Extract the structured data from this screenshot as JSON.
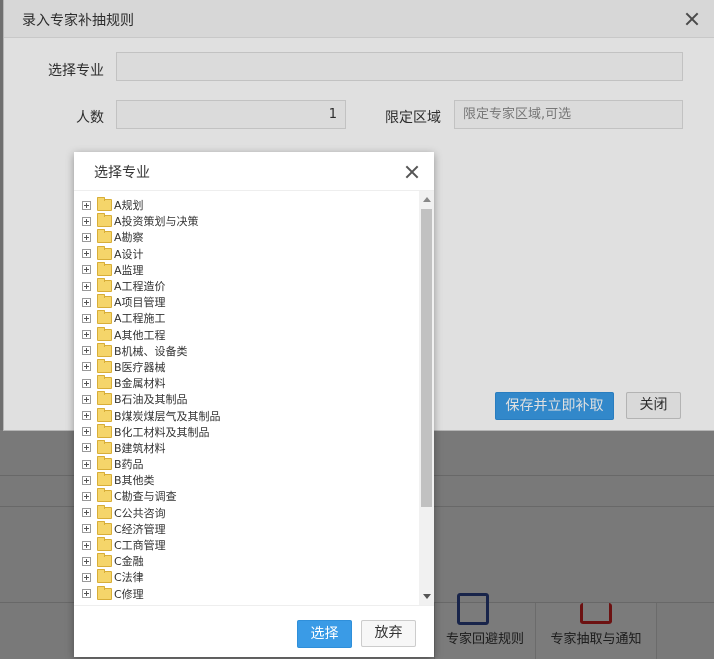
{
  "outer_dialog": {
    "title": "录入专家补抽规则",
    "major_label": "选择专业",
    "major_value": "",
    "count_label": "人数",
    "count_value": "1",
    "region_label": "限定区域",
    "region_placeholder": "限定专家区域,可选",
    "save_button": "保存并立即补取",
    "close_button": "关闭"
  },
  "background": {
    "tiles": [
      "专家回避规则",
      "专家抽取与通知"
    ]
  },
  "inner_dialog": {
    "title": "选择专业",
    "tree_items": [
      "A规划",
      "A投资策划与决策",
      "A勘察",
      "A设计",
      "A监理",
      "A工程造价",
      "A项目管理",
      "A工程施工",
      "A其他工程",
      "B机械、设备类",
      "B医疗器械",
      "B金属材料",
      "B石油及其制品",
      "B煤炭煤层气及其制品",
      "B化工材料及其制品",
      "B建筑材料",
      "B药品",
      "B其他类",
      "C勘查与调查",
      "C公共咨询",
      "C经济管理",
      "C工商管理",
      "C金融",
      "C法律",
      "C修理"
    ],
    "select_button": "选择",
    "cancel_button": "放弃"
  }
}
